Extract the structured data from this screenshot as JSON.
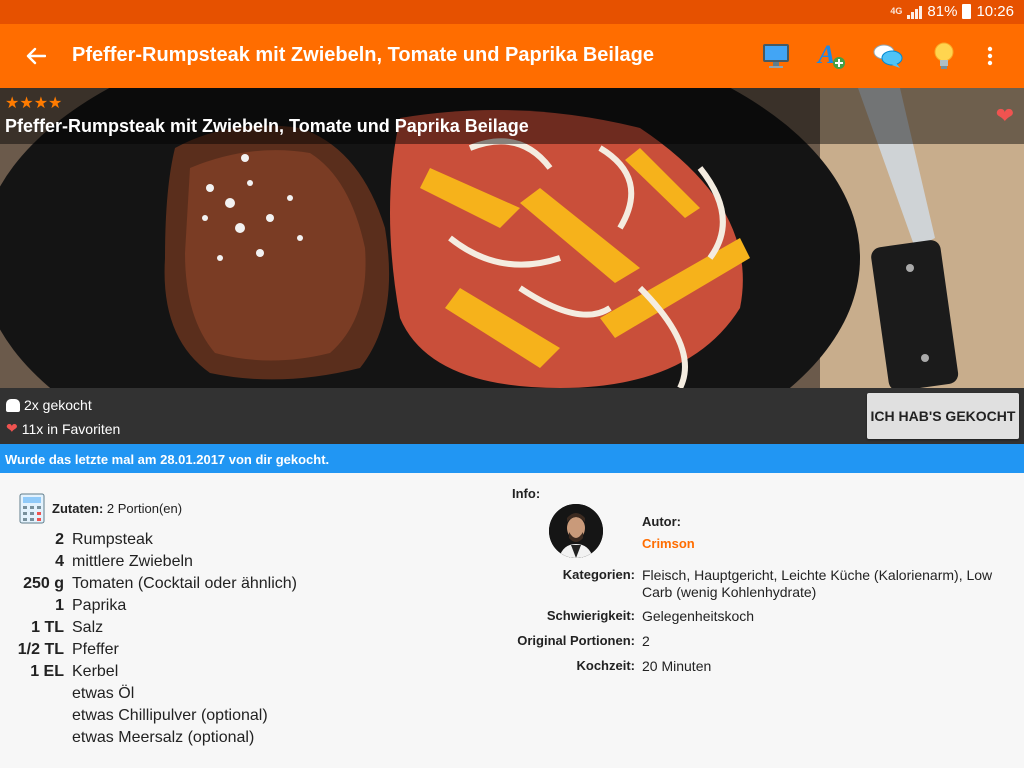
{
  "status_bar": {
    "network": "4G",
    "battery": "81%",
    "time": "10:26"
  },
  "app_bar": {
    "title": "Pfeffer-Rumpsteak mit Zwiebeln, Tomate und Paprika Beilage",
    "actions": [
      "monitor-icon",
      "font-add-icon",
      "chat-bubbles-icon",
      "lightbulb-icon",
      "overflow-menu-icon"
    ]
  },
  "hero": {
    "stars": "★★★★",
    "title": "Pfeffer-Rumpsteak mit Zwiebeln, Tomate und Paprika Beilage",
    "rating": 4
  },
  "stats": {
    "cooked": "2x gekocht",
    "favorites": "11x in Favoriten",
    "cooked_button": "ICH HAB'S GEKOCHT"
  },
  "info_strip": "Wurde das letzte mal am 28.01.2017 von dir gekocht.",
  "ingredients": {
    "header_label": "Zutaten:",
    "portions": "2 Portion(en)",
    "items": [
      {
        "qty": "2",
        "name": "Rumpsteak"
      },
      {
        "qty": "4",
        "name": "mittlere Zwiebeln"
      },
      {
        "qty": "250 g",
        "name": "Tomaten (Cocktail oder ähnlich)"
      },
      {
        "qty": "1",
        "name": "Paprika"
      },
      {
        "qty": "1 TL",
        "name": "Salz"
      },
      {
        "qty": "1/2 TL",
        "name": "Pfeffer"
      },
      {
        "qty": "1 EL",
        "name": "Kerbel"
      },
      {
        "qty": "",
        "name": "etwas Öl"
      },
      {
        "qty": "",
        "name": "etwas Chillipulver (optional)"
      },
      {
        "qty": "",
        "name": "etwas Meersalz  (optional)"
      }
    ]
  },
  "info": {
    "label": "Info:",
    "author_label": "Autor:",
    "author": "Crimson",
    "rows": [
      {
        "key": "Kategorien:",
        "value": "Fleisch, Hauptgericht, Leichte Küche (Kalorienarm), Low Carb (wenig Kohlenhydrate)"
      },
      {
        "key": "Schwierigkeit:",
        "value": "Gelegenheitskoch"
      },
      {
        "key": "Original Portionen:",
        "value": "2"
      },
      {
        "key": "Kochzeit:",
        "value": "20 Minuten"
      }
    ]
  },
  "colors": {
    "status_bar": "#e65100",
    "app_bar": "#ff6d00",
    "accent": "#ff6d00",
    "info_strip": "#2196f3",
    "stats_bar": "#323232"
  }
}
